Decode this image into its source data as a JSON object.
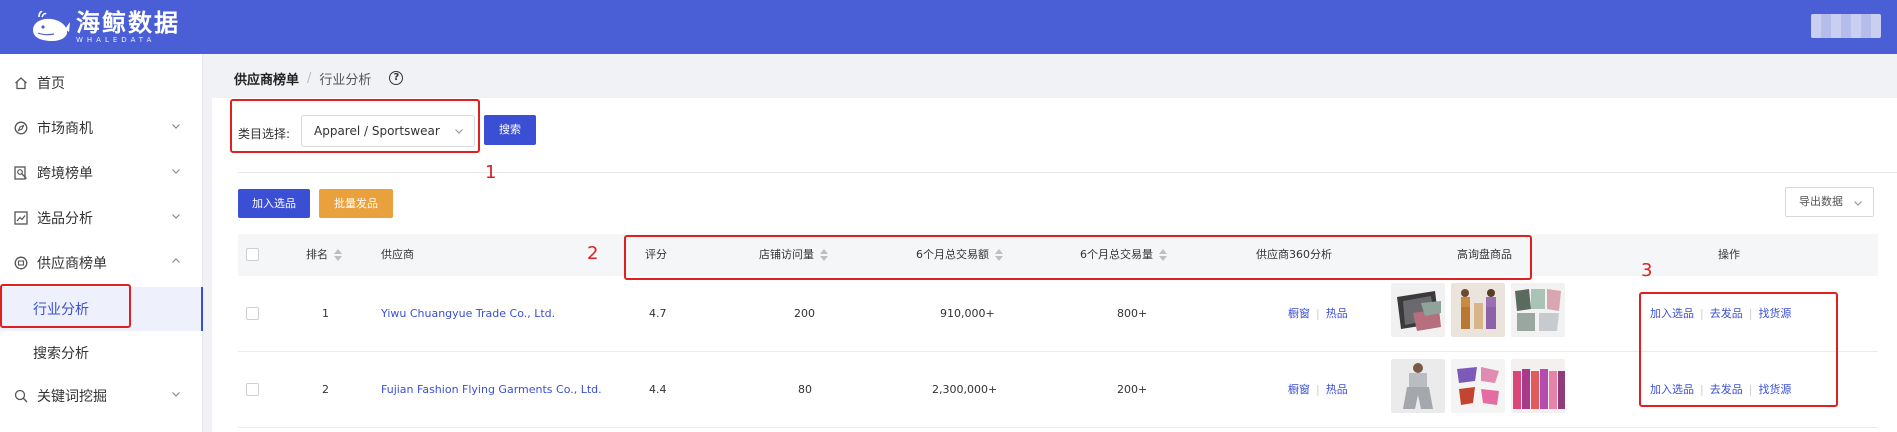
{
  "brand": {
    "name_cn": "海鲸数据",
    "name_en": "WHALEDATA",
    "color": "#4a5ed6"
  },
  "sidebar": {
    "items": [
      {
        "label": "首页",
        "icon": "home-icon"
      },
      {
        "label": "市场商机",
        "icon": "compass-icon"
      },
      {
        "label": "跨境榜单",
        "icon": "rank-search-icon"
      },
      {
        "label": "选品分析",
        "icon": "trend-chart-icon"
      },
      {
        "label": "供应商榜单",
        "icon": "supplier-icon"
      },
      {
        "label": "关键词挖掘",
        "icon": "magnify-icon"
      }
    ],
    "sub_items": [
      {
        "label": "行业分析",
        "active": true
      },
      {
        "label": "搜索分析",
        "active": false
      }
    ]
  },
  "breadcrumb": {
    "parent": "供应商榜单",
    "separator": "/",
    "current": "行业分析",
    "help": "?"
  },
  "filter": {
    "label": "类目选择:",
    "selected_category": "Apparel / Sportswear",
    "search_button": "搜索"
  },
  "actions": {
    "add_selection": "加入选品",
    "batch_publish": "批量发品",
    "export": "导出数据"
  },
  "table": {
    "headers": {
      "rank": "排名",
      "supplier": "供应商",
      "rating": "评分",
      "visits": "店铺访问量",
      "amount": "6个月总交易额",
      "volume": "6个月总交易量",
      "analysis": "供应商360分析",
      "products": "高询盘商品",
      "ops": "操作"
    },
    "rows": [
      {
        "rank": "1",
        "supplier": "Yiwu Chuangyue Trade Co., Ltd.",
        "rating": "4.7",
        "visits": "200",
        "amount": "910,000+",
        "volume": "800+",
        "analysis": {
          "a": "橱窗",
          "b": "热品"
        },
        "ops": {
          "add": "加入选品",
          "publish": "去发品",
          "source": "找货源"
        }
      },
      {
        "rank": "2",
        "supplier": "Fujian Fashion Flying Garments Co., Ltd.",
        "rating": "4.4",
        "visits": "80",
        "amount": "2,300,000+",
        "volume": "200+",
        "analysis": {
          "a": "橱窗",
          "b": "热品"
        },
        "ops": {
          "add": "加入选品",
          "publish": "去发品",
          "source": "找货源"
        }
      }
    ]
  },
  "annotations": {
    "n1": "1",
    "n2": "2",
    "n3": "3",
    "color": "#e02020"
  }
}
